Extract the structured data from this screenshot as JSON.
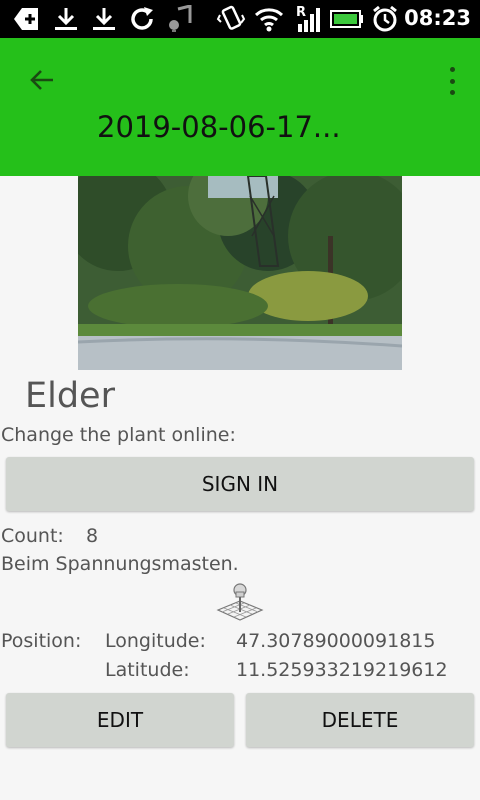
{
  "status_bar": {
    "time": "08:23",
    "icons": [
      "add-icon",
      "download-icon",
      "download-icon",
      "sync-icon",
      "music-icon",
      "vibrate-icon",
      "wifi-icon",
      "signal-roaming-icon",
      "battery-icon",
      "alarm-icon"
    ]
  },
  "app_bar": {
    "title": "2019-08-06-17...",
    "color": "#25c01a"
  },
  "plant": {
    "name": "Elder",
    "change_label": "Change the plant online:",
    "sign_in_label": "SIGN IN",
    "count_label": "Count:",
    "count_value": "8",
    "note": "Beim Spannungsmasten.",
    "position_label": "Position:",
    "longitude_label": "Longitude:",
    "longitude_value": "47.30789000091815",
    "latitude_label": "Latitude:",
    "latitude_value": "11.525933219219612"
  },
  "actions": {
    "edit_label": "EDIT",
    "delete_label": "DELETE"
  }
}
